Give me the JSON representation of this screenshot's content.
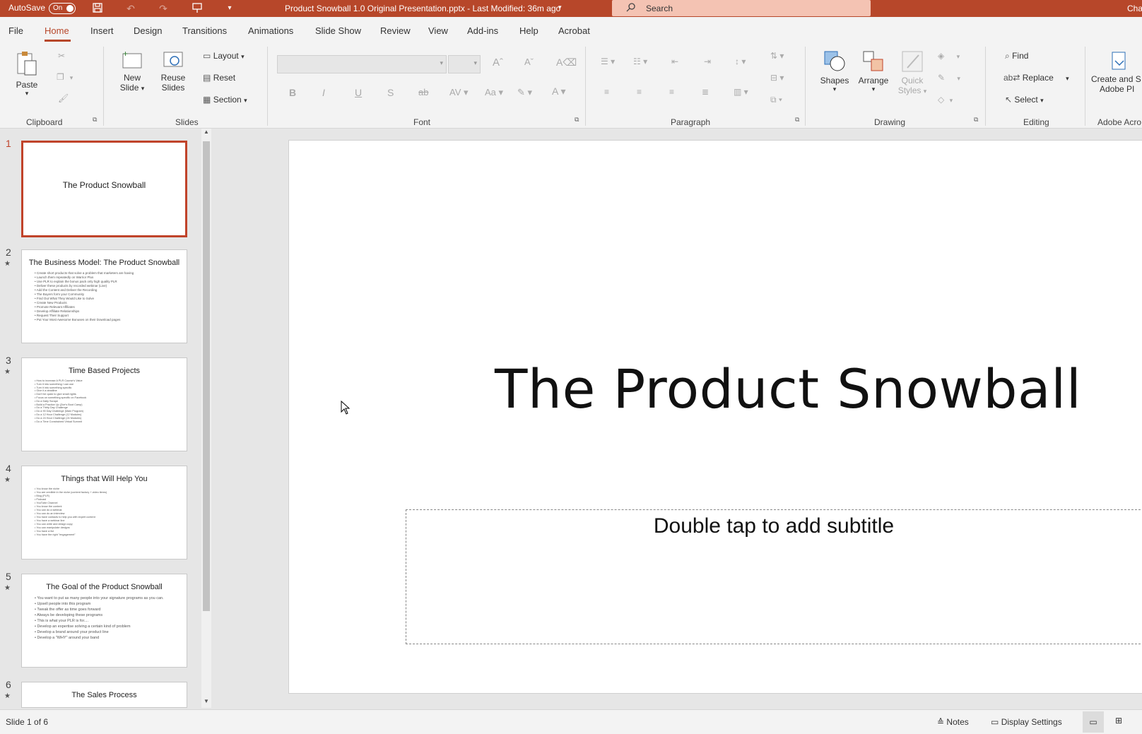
{
  "titlebar": {
    "autosave_label": "AutoSave",
    "autosave_state": "On",
    "document_title": "Product Snowball 1.0 Original Presentation.pptx  -  Last Modified: 36m ago",
    "search_placeholder": "Search",
    "user_partial": "Cha"
  },
  "tabs": [
    "File",
    "Home",
    "Insert",
    "Design",
    "Transitions",
    "Animations",
    "Slide Show",
    "Review",
    "View",
    "Add-ins",
    "Help",
    "Acrobat"
  ],
  "ribbon": {
    "clipboard": {
      "paste": "Paste",
      "group": "Clipboard"
    },
    "slides": {
      "new_slide_1": "New",
      "new_slide_2": "Slide",
      "reuse_1": "Reuse",
      "reuse_2": "Slides",
      "layout": "Layout",
      "reset": "Reset",
      "section": "Section",
      "group": "Slides"
    },
    "font": {
      "group": "Font"
    },
    "paragraph": {
      "group": "Paragraph"
    },
    "drawing": {
      "shapes": "Shapes",
      "arrange": "Arrange",
      "quick_1": "Quick",
      "quick_2": "Styles",
      "group": "Drawing"
    },
    "editing": {
      "find": "Find",
      "replace": "Replace",
      "select": "Select",
      "group": "Editing"
    },
    "acrobat": {
      "line1": "Create and S",
      "line2": "Adobe PI",
      "group": "Adobe Acro"
    }
  },
  "thumbnails": [
    {
      "num": "1",
      "title": "The Product Snowball",
      "bullets": ""
    },
    {
      "num": "2",
      "title": "The Business Model: The Product Snowball",
      "bullets": "• Create short products that solve a problem that marketers are having\n• Launch them repeatedly on Warrior Plus\n• Use PLR to explain the bonus pack only high quality PLR\n• Deliver these products by recorded webinar (Live)\n• Add the Content and Deliver the Recording\n• The Buyers form your Community\n• Find Out What They Would Like to Solve\n• Create New Products\n• Promote Relevant Affiliates\n• Develop Affiliate Relationships\n• Request Their Support\n• Put Your Most Awesome Bonuses on their Download pages"
    },
    {
      "num": "3",
      "title": "Time Based Projects",
      "bullets": "• How to increase A PLR Course's Value\n   • Turn it into something I can use\n   • Turn it into something specific\n   • Give it a deadline\n   • Don't be quick to give small rights\n• Focus on something specific on Facebook\n   • Do a Daily Scrape\n   • Build a Practice Up (Zoe's Boot Camp)\n   • Do a Thirty Day Challenge\n   • Do a 90 Day Challenge (Main Program)\n   • Do a 12 Hour Challenge (12 Modules)\n   • Do a 24 Hour Challenge (24 Modules)\n   • Do a Time Constrained Virtual Summit"
    },
    {
      "num": "4",
      "title": "Things that Will Help You",
      "bullets": "• You know the niche\n• You are credible in the niche (content factory + video items)\n   • Blog (PLR)\n   • Podcast\n   • YouTube Channel\n• You know the content\n• You can do a webinar\n• You can do an interview\n• You have contacts to help you with expert content\n• You have a webinar line\n• You can write and design copy\n• You can manipulate designs\n• You have a list\n• You have the right \"engagement\""
    },
    {
      "num": "5",
      "title": "The Goal of the Product Snowball",
      "bullets": "• You want to put as many people into your signature programs as you can.\n• Upsell people into this program\n• Tweak the offer as time goes forward\n• Always be developing these programs\n• This is what your PLR is for....\n• Develop an expertise solving a certain kind of problem\n• Develop a brand around your product line\n• Develop a \"WHY\" around your band"
    },
    {
      "num": "6",
      "title": "The Sales Process",
      "bullets": ""
    }
  ],
  "slide": {
    "title": "The Product Snowball",
    "subtitle_placeholder": "Double tap to add subtitle"
  },
  "status": {
    "slide_count": "Slide 1 of 6",
    "notes": "Notes",
    "display_settings": "Display Settings"
  }
}
